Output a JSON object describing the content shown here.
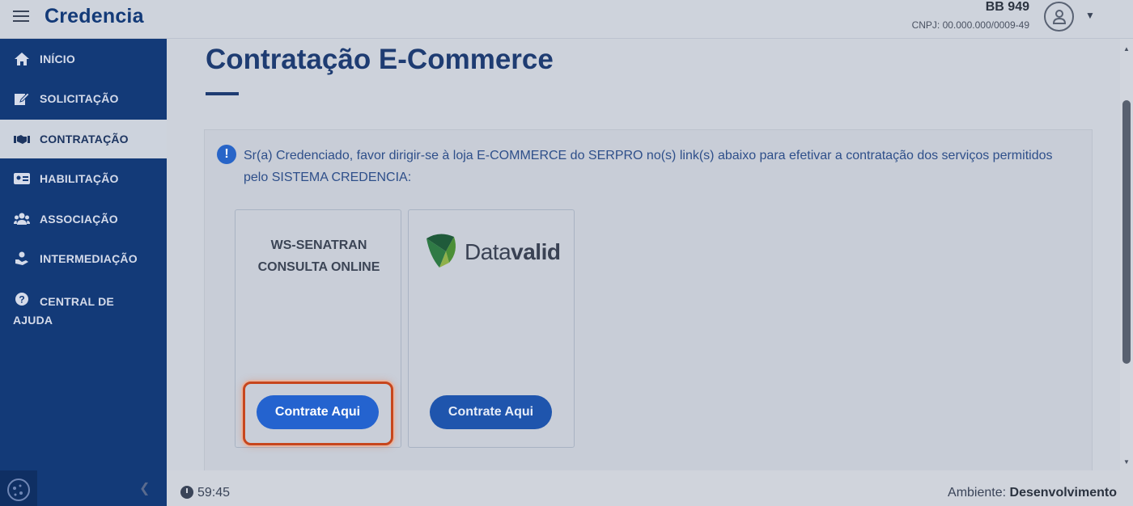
{
  "header": {
    "brand": "Credencia",
    "user_name": "BB 949",
    "user_cnpj": "CNPJ: 00.000.000/0009-49"
  },
  "sidebar": {
    "items": [
      {
        "label": "INÍCIO",
        "icon": "home-icon"
      },
      {
        "label": "SOLICITAÇÃO",
        "icon": "edit-document-icon"
      },
      {
        "label": "CONTRATAÇÃO",
        "icon": "handshake-icon",
        "active": true
      },
      {
        "label": "HABILITAÇÃO",
        "icon": "id-card-icon"
      },
      {
        "label": "ASSOCIAÇÃO",
        "icon": "users-icon"
      },
      {
        "label": "INTERMEDIAÇÃO",
        "icon": "hand-user-icon"
      },
      {
        "label": "CENTRAL DE AJUDA",
        "icon": "question-circle-icon"
      }
    ]
  },
  "main": {
    "title": "Contratação E-Commerce",
    "info": "Sr(a) Credenciado, favor dirigir-se à loja E-COMMERCE do SERPRO no(s) link(s) abaixo para efetivar a contratação dos serviços permitidos pelo SISTEMA CREDENCIA:",
    "cards": [
      {
        "title_line1": "WS-SENATRAN",
        "title_line2": "CONSULTA ONLINE",
        "button": "Contrate Aqui"
      },
      {
        "logo_text_light": "Data",
        "logo_text_bold": "valid",
        "button": "Contrate Aqui"
      }
    ]
  },
  "footer": {
    "timer": "59:45",
    "env_label": "Ambiente:",
    "env_value": "Desenvolvimento"
  },
  "colors": {
    "primary": "#133a78",
    "button": "#2463cf",
    "highlight": "#c7461d"
  }
}
